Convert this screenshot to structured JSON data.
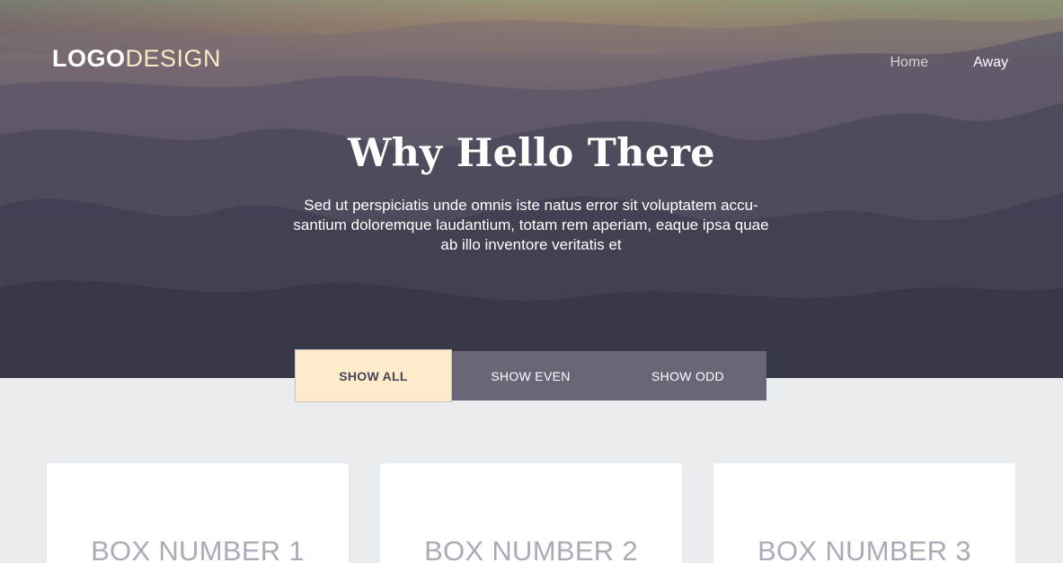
{
  "header": {
    "logo_bold": "LOGO",
    "logo_light": "DESIGN",
    "nav": [
      {
        "label": "Home"
      },
      {
        "label": "Away"
      }
    ]
  },
  "hero": {
    "title": "Why Hello There",
    "text": "Sed ut perspiciatis unde omnis iste natus error sit voluptatem accu-santium doloremque laudantium, totam rem aperiam, eaque ipsa quae ab illo inventore veritatis et"
  },
  "filters": [
    {
      "label": "SHOW ALL",
      "active": true
    },
    {
      "label": "SHOW EVEN",
      "active": false
    },
    {
      "label": "SHOW ODD",
      "active": false
    }
  ],
  "boxes": [
    {
      "label": "BOX NUMBER 1"
    },
    {
      "label": "BOX NUMBER 2"
    },
    {
      "label": "BOX NUMBER 3"
    }
  ],
  "colors": {
    "accent": "#feebcc",
    "button": "#6b6578",
    "page_bg": "#e9edf0",
    "box_text": "#a9abb7"
  }
}
